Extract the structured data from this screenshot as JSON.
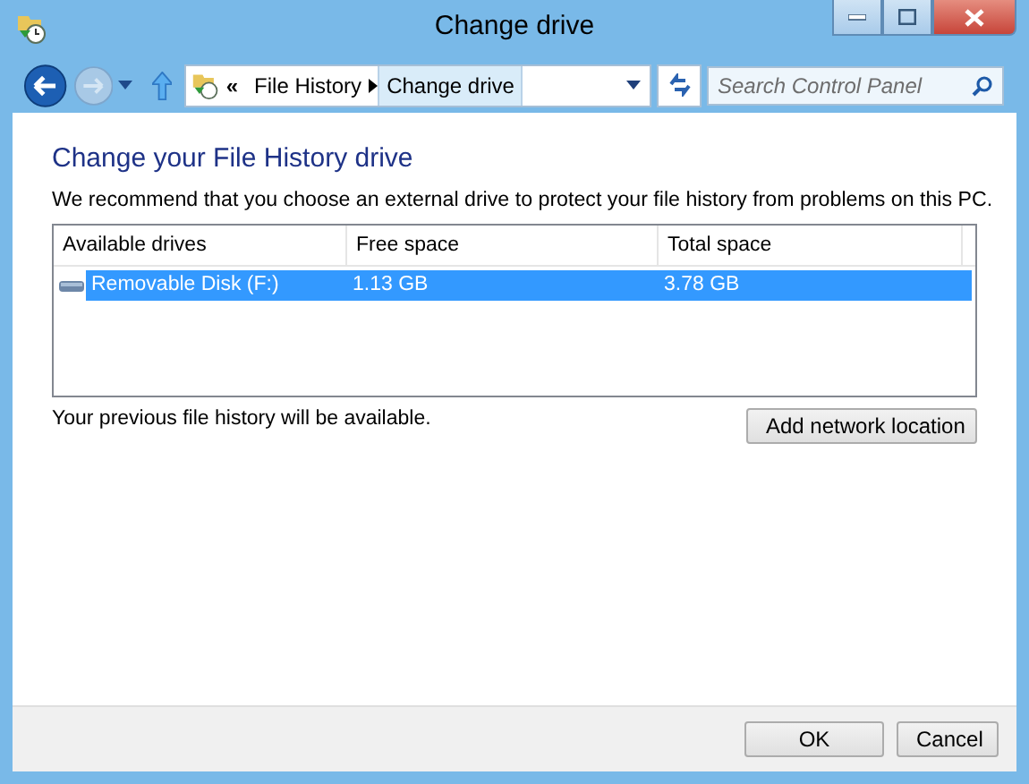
{
  "window": {
    "title": "Change drive"
  },
  "address_bar": {
    "overflow": "«",
    "breadcrumb": [
      "File History",
      "Change drive"
    ]
  },
  "search": {
    "placeholder": "Search Control Panel"
  },
  "heading": "Change your File History drive",
  "description": "We recommend that you choose an external drive to protect your file history from problems on this PC.",
  "table": {
    "columns": [
      "Available drives",
      "Free space",
      "Total space"
    ],
    "rows": [
      {
        "cells": [
          "Removable Disk (F:)",
          "1.13 GB",
          "3.78 GB"
        ],
        "selected": true
      }
    ]
  },
  "note": "Your previous file history will be available.",
  "add_button": "Add network location",
  "buttons": [
    "OK",
    "Cancel"
  ]
}
